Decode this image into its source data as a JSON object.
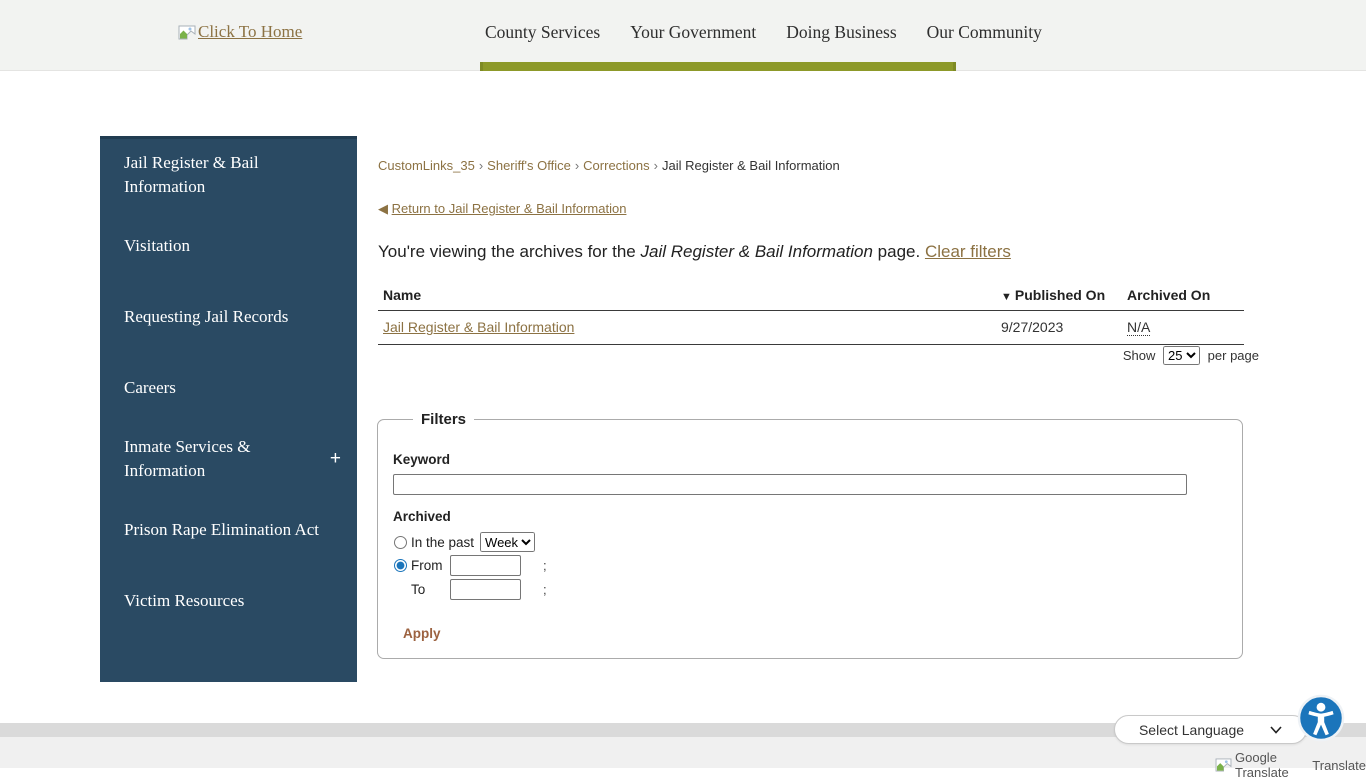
{
  "header": {
    "logo": {
      "label": "Click To Home"
    },
    "nav": [
      {
        "label": "County Services"
      },
      {
        "label": "Your Government"
      },
      {
        "label": "Doing Business"
      },
      {
        "label": "Our Community"
      }
    ]
  },
  "sidebar": {
    "items": [
      {
        "label": "Jail Register & Bail Information"
      },
      {
        "label": "Visitation"
      },
      {
        "label": "Requesting Jail Records"
      },
      {
        "label": "Careers"
      },
      {
        "label": "Inmate Services & Information",
        "expand_glyph": "+"
      },
      {
        "label": "Prison Rape Elimination Act"
      },
      {
        "label": "Victim Resources"
      }
    ]
  },
  "breadcrumb": {
    "links": [
      "CustomLinks_35",
      "Sheriff's Office",
      "Corrections"
    ],
    "separator": "›",
    "current": "Jail Register & Bail Information"
  },
  "archive": {
    "return_arrow": "◀",
    "return_label": "Return to Jail Register & Bail Information",
    "intro_prefix": "You're viewing the archives for the ",
    "page_name": "Jail Register & Bail Information",
    "intro_suffix": " page. ",
    "clear_filters_label": "Clear filters"
  },
  "table": {
    "sort_indicator": "▼",
    "columns": {
      "name": "Name",
      "published": "Published On",
      "archived": "Archived On"
    },
    "rows": [
      {
        "name": "Jail Register & Bail Information",
        "published_on": "9/27/2023",
        "archived_on": "N/A"
      }
    ]
  },
  "pagination": {
    "show_label": "Show",
    "selected": "25",
    "per_page_label": "per page"
  },
  "filters": {
    "legend": "Filters",
    "keyword_label": "Keyword",
    "keyword_value": "",
    "archived_label": "Archived",
    "in_the_past_label": "In the past",
    "period_selected": "Week",
    "from_label": "From",
    "to_label": "To",
    "from_value": "",
    "to_value": "",
    "separator_char": ";",
    "apply_label": "Apply"
  },
  "footer": {
    "language_label": "Select Language",
    "translate_alt": "Google Translate",
    "translate_label": "Translate"
  },
  "colors": {
    "accent_olive": "#8d9929",
    "sidebar_blue": "#2a4a63",
    "link_brown": "#8c7243",
    "apply_brown": "#9c6240",
    "a11y_blue": "#1b75bb"
  }
}
